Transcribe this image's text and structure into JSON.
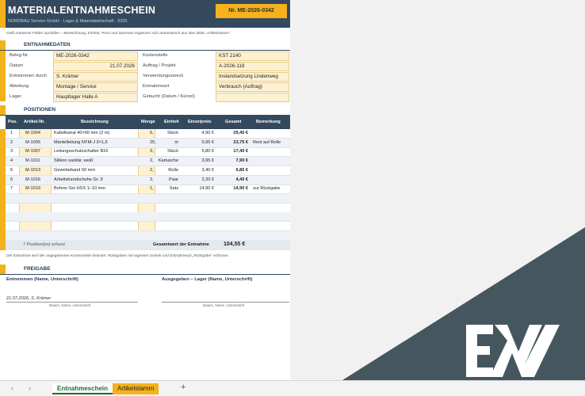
{
  "header": {
    "title": "MATERIALENTNAHMESCHEIN",
    "subtitle": "NORDBAU Service GmbH · Lager & Materialwirtschaft · 2026",
    "doc_number": "Nr. ME-2026-0342"
  },
  "hint": "Gelb markierte Felder ausfüllen – Bezeichnung, Einheit, Preis und Summen ergänzen sich automatisch aus dem Blatt „Artikelstamm“.",
  "entnahmedaten": {
    "section_title": "ENTNAHMEDATEN",
    "left": [
      {
        "label": "Beleg-Nr.",
        "value": "ME-2026-0342"
      },
      {
        "label": "Datum",
        "value": "21.07.2026"
      },
      {
        "label": "Entnommen durch",
        "value": "S. Krämer"
      },
      {
        "label": "Abteilung",
        "value": "Montage / Service"
      },
      {
        "label": "Lager",
        "value": "Hauptlager Halle A"
      }
    ],
    "right": [
      {
        "label": "Kostenstelle",
        "value": "KST 2140"
      },
      {
        "label": "Auftrag / Projekt",
        "value": "A-2026-118"
      },
      {
        "label": "Verwendungszweck",
        "value": "Instandsetzung Lindenweg"
      },
      {
        "label": "Entnahmeart",
        "value": "Verbrauch (Auftrag)"
      },
      {
        "label": "Gebucht (Datum / Kürzel)",
        "value": ""
      }
    ]
  },
  "positionen": {
    "section_title": "POSITIONEN",
    "columns": [
      "Pos.",
      "Artikel-Nr.",
      "Bezeichnung",
      "Menge",
      "Einheit",
      "Einzelpreis",
      "Gesamt",
      "Bemerkung"
    ],
    "rows": [
      {
        "pos": "1",
        "art": "M-1004",
        "bez": "Kabelkanal 40×60 mm (2 m)",
        "menge": "6,",
        "einheit": "Stück",
        "preis": "4,90 €",
        "gesamt": "29,40 €",
        "bem": ""
      },
      {
        "pos": "2",
        "art": "M-1005",
        "bez": "Mantelleitung NYM-J 3×1,5",
        "menge": "25,",
        "einheit": "m",
        "preis": "0,95 €",
        "gesamt": "23,75 €",
        "bem": "Rest auf Rolle"
      },
      {
        "pos": "3",
        "art": "M-1007",
        "bez": "Leitungsschutzschalter B16",
        "menge": "3,",
        "einheit": "Stück",
        "preis": "5,80 €",
        "gesamt": "17,40 €",
        "bem": ""
      },
      {
        "pos": "4",
        "art": "M-1011",
        "bez": "Silikon sanitär, weiß",
        "menge": "2,",
        "einheit": "Kartusche",
        "preis": "3,95 €",
        "gesamt": "7,90 €",
        "bem": ""
      },
      {
        "pos": "5",
        "art": "M-1013",
        "bez": "Gewebeband 50 mm",
        "menge": "2,",
        "einheit": "Rolle",
        "preis": "3,40 €",
        "gesamt": "6,80 €",
        "bem": ""
      },
      {
        "pos": "6",
        "art": "M-1016",
        "bez": "Arbeitshandschuhe Gr. 9",
        "menge": "2,",
        "einheit": "Paar",
        "preis": "2,20 €",
        "gesamt": "4,40 €",
        "bem": ""
      },
      {
        "pos": "7",
        "art": "M-1019",
        "bez": "Bohrer-Set HSS 1–10 mm",
        "menge": "1,",
        "einheit": "Satz",
        "preis": "14,90 €",
        "gesamt": "14,90 €",
        "bem": "zur Rückgabe"
      }
    ],
    "summary_count": "7 Position(en) erfasst",
    "total_label": "Gesamtwert der Entnahme",
    "total_value": "104,55 €"
  },
  "note": "Die Entnahme wird der angegebenen Kostenstelle belastet. Rückgaben mit eigenem Schein und Entnahmeart „Rückgabe“ erfassen.",
  "freigabe": {
    "section_title": "FREIGABE",
    "left_label": "Entnommen (Name, Unterschrift)",
    "right_label": "Ausgegeben – Lager (Name, Unterschrift)",
    "left_value": "21.07.2026, S. Krämer",
    "caption": "Datum, Name, Unterschrift"
  },
  "tabs": {
    "nav_prev": "‹",
    "nav_next": "›",
    "sheet1": "Entnahmeschein",
    "sheet2": "Artikelstamm",
    "add": "+"
  },
  "colors": {
    "header_navy": "#34495e",
    "accent_yellow": "#f5b21b",
    "input_fill": "#fdf1d2"
  }
}
